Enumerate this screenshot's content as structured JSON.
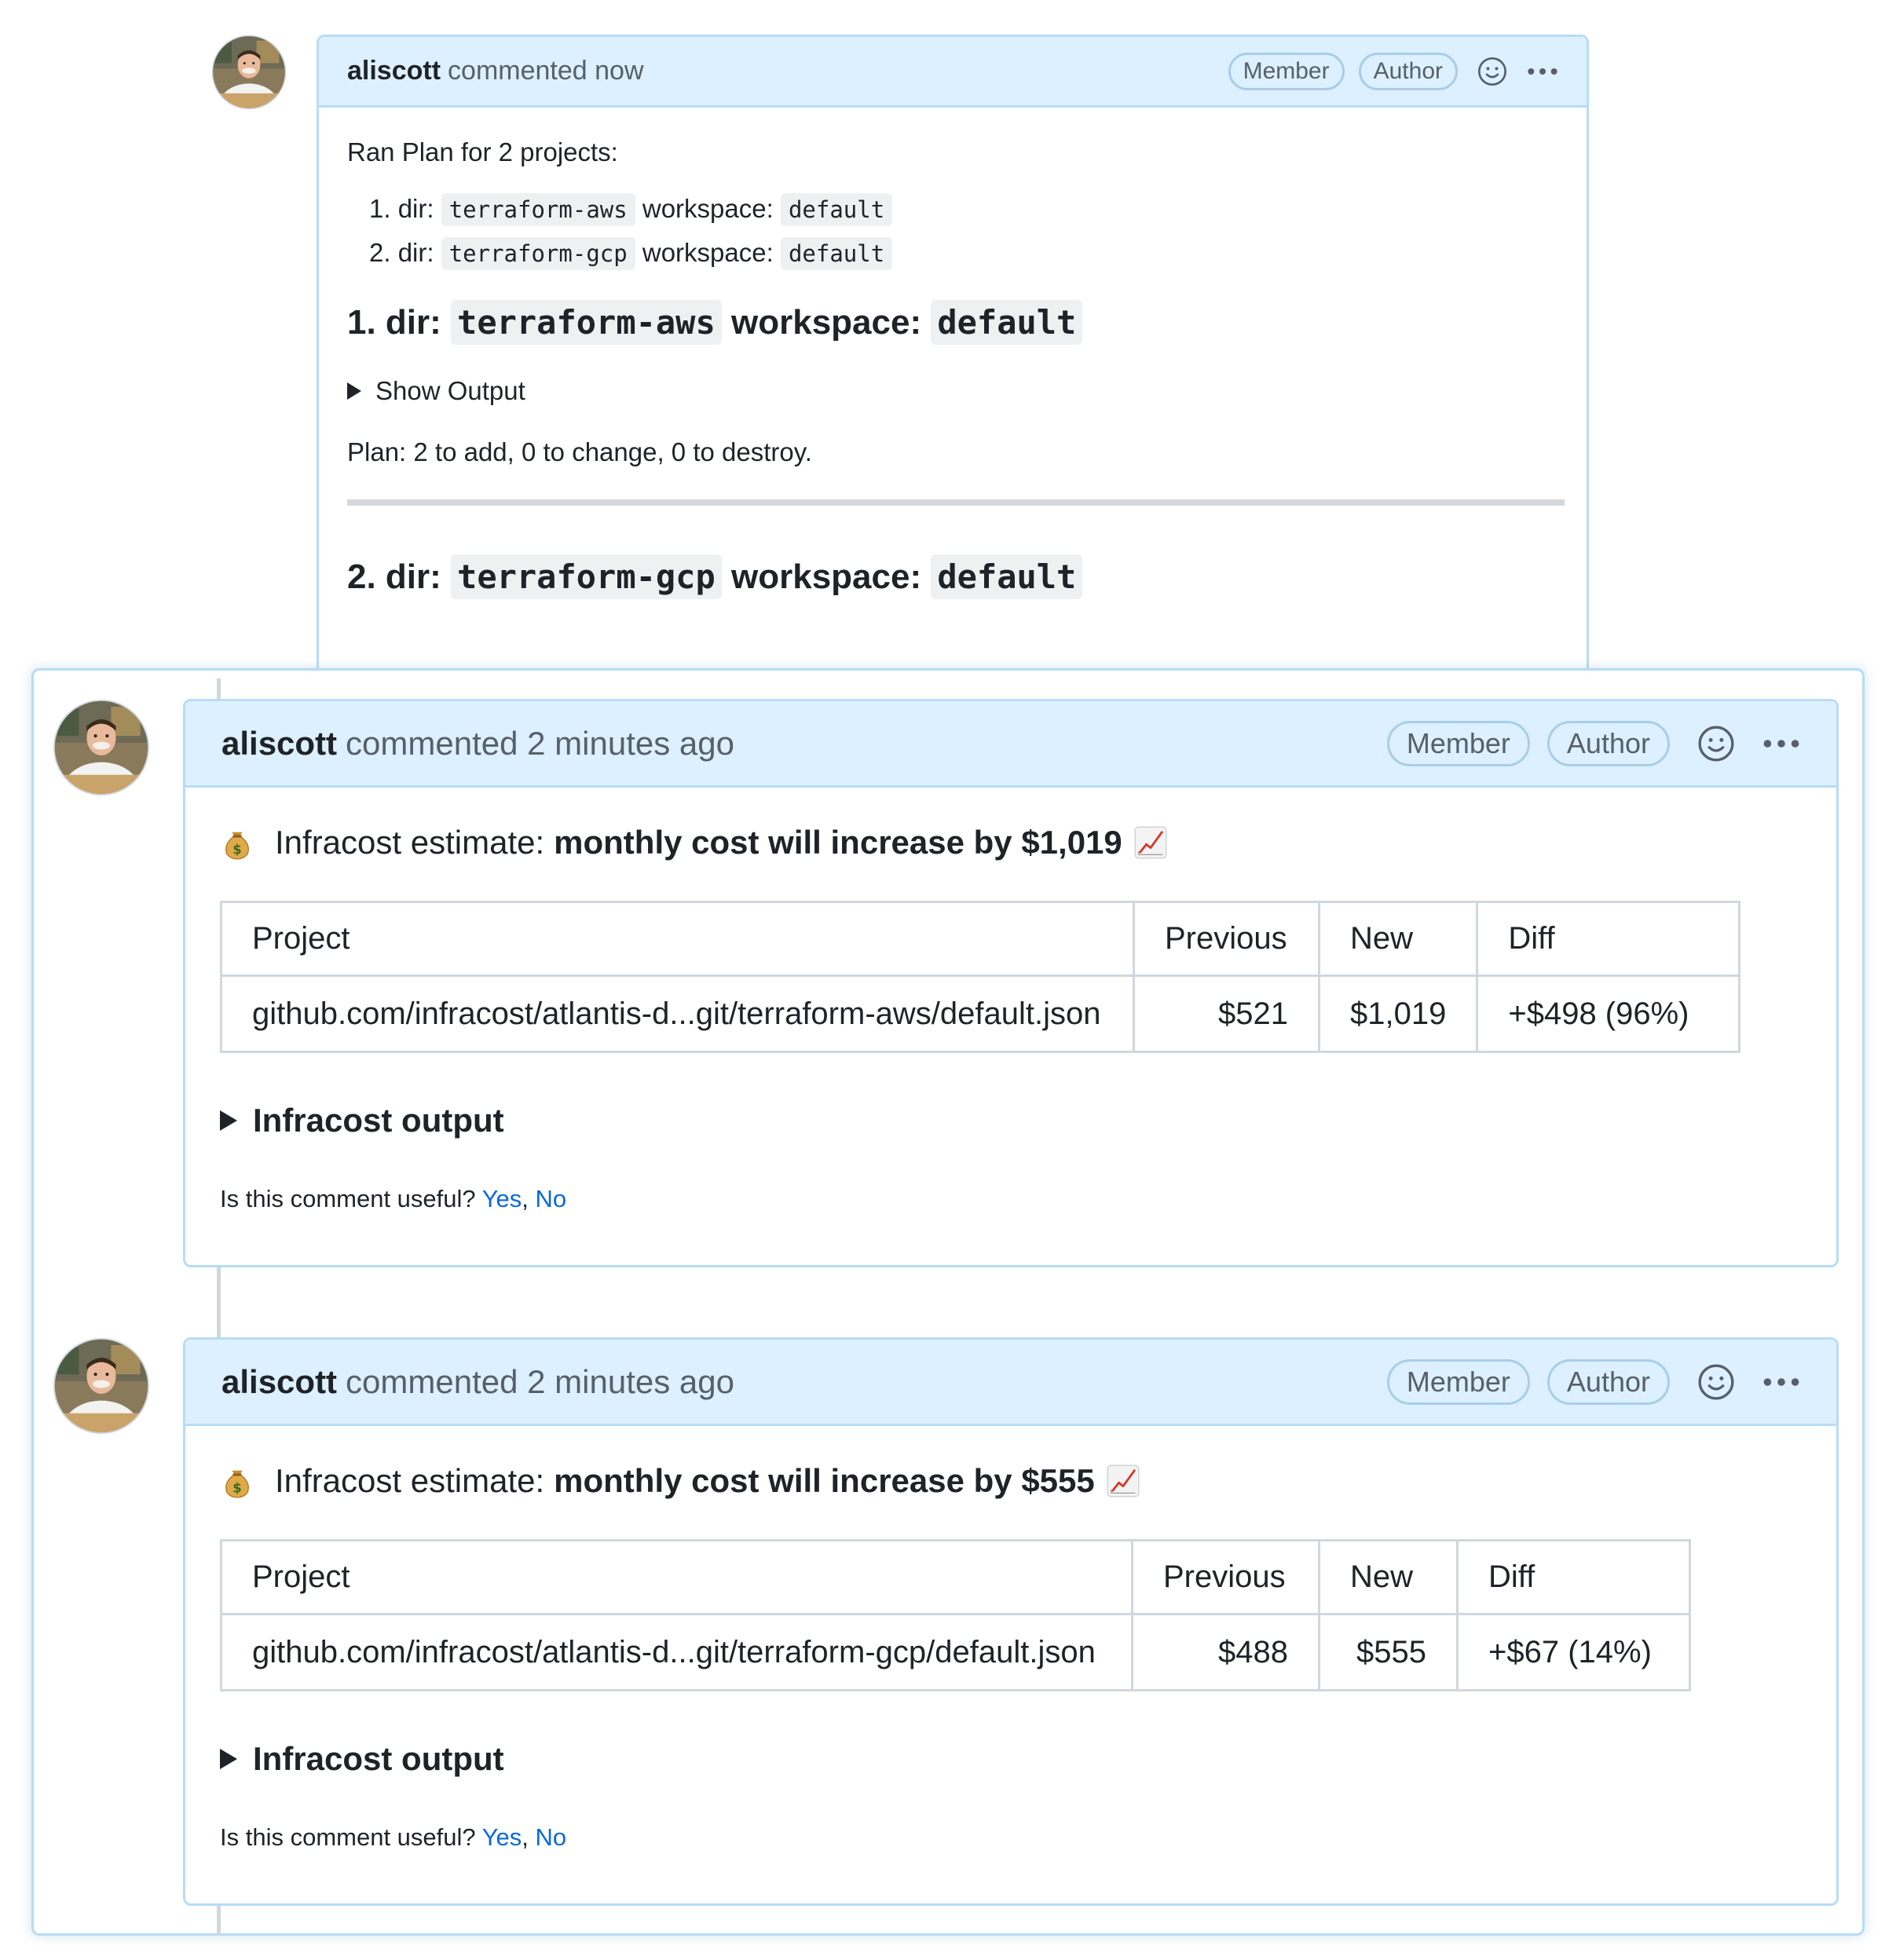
{
  "background_comment": {
    "author": "aliscott",
    "action_time": "commented now",
    "badges": [
      "Member",
      "Author"
    ],
    "intro": "Ran Plan for 2 projects:",
    "projects": [
      {
        "number": "1. dir:",
        "dir": "terraform-aws",
        "ws_label": "workspace:",
        "workspace": "default"
      },
      {
        "number": "2. dir:",
        "dir": "terraform-gcp",
        "ws_label": "workspace:",
        "workspace": "default"
      }
    ],
    "section1": {
      "prefix": "1. dir:",
      "dir": "terraform-aws",
      "ws_label": "workspace:",
      "workspace": "default"
    },
    "show_output": "Show Output",
    "plan_summary": "Plan: 2 to add, 0 to change, 0 to destroy.",
    "section2": {
      "prefix": "2. dir:",
      "dir": "terraform-gcp",
      "ws_label": "workspace:",
      "workspace": "default"
    }
  },
  "comments": [
    {
      "author": "aliscott",
      "action_time": "commented 2 minutes ago",
      "badges": [
        "Member",
        "Author"
      ],
      "estimate_prefix": "Infracost estimate:",
      "estimate_bold": "monthly cost will increase by $1,019",
      "table_headers": [
        "Project",
        "Previous",
        "New",
        "Diff"
      ],
      "row": {
        "project": "github.com/infracost/atlantis-d...git/terraform-aws/default.json",
        "previous": "$521",
        "new": "$1,019",
        "diff": "+$498 (96%)"
      },
      "output_label": "Infracost output",
      "useful_q": "Is this comment useful?",
      "yes": "Yes",
      "no": "No"
    },
    {
      "author": "aliscott",
      "action_time": "commented 2 minutes ago",
      "badges": [
        "Member",
        "Author"
      ],
      "estimate_prefix": "Infracost estimate:",
      "estimate_bold": "monthly cost will increase by $555",
      "table_headers": [
        "Project",
        "Previous",
        "New",
        "Diff"
      ],
      "row": {
        "project": "github.com/infracost/atlantis-d...git/terraform-gcp/default.json",
        "previous": "$488",
        "new": "$555",
        "diff": "+$67 (14%)"
      },
      "output_label": "Infracost output",
      "useful_q": "Is this comment useful?",
      "yes": "Yes",
      "no": "No"
    }
  ],
  "icons": {
    "reaction": "smiley-icon",
    "menu": "kebab-horizontal-icon",
    "estimate_leading": "money-bag-icon",
    "estimate_trailing": "chart-increasing-icon",
    "disclosure": "triangle-right-icon",
    "avatar": "user-avatar"
  },
  "colors": {
    "header_bg": "#ddf0ff",
    "border": "#b6dcf7",
    "link": "#0969da",
    "muted": "#57606a"
  }
}
